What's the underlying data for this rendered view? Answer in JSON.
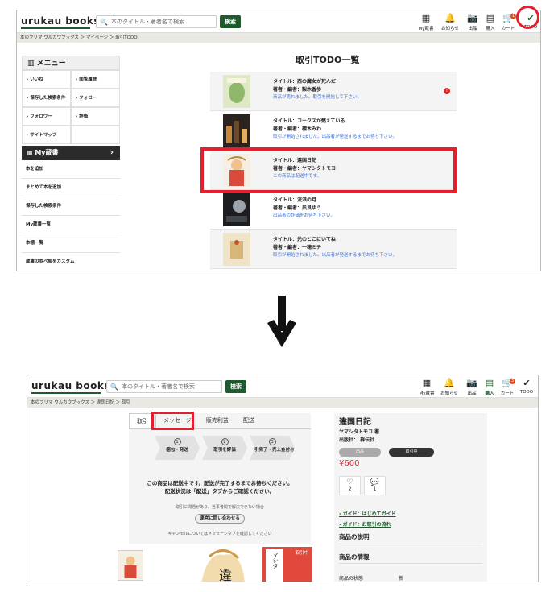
{
  "header": {
    "logo": "urukau books",
    "search_placeholder": "本のタイトル・著者名で検索",
    "search_button": "検索",
    "nav1": [
      {
        "label": "My蔵書",
        "icon": "bookshelf-icon"
      },
      {
        "label": "お知らせ",
        "icon": "bell-icon"
      },
      {
        "label": "出品",
        "icon": "camera-icon"
      },
      {
        "label": "購入",
        "icon": "shop-icon"
      },
      {
        "label": "カート",
        "icon": "cart-icon",
        "badge": "1"
      },
      {
        "label": "TODO",
        "icon": "check-icon"
      }
    ],
    "nav2": [
      {
        "label": "My蔵書",
        "icon": "bookshelf-icon"
      },
      {
        "label": "お知らせ",
        "icon": "bell-icon"
      },
      {
        "label": "出品",
        "icon": "camera-icon"
      },
      {
        "label": "購入",
        "icon": "shop-icon"
      },
      {
        "label": "カート",
        "icon": "cart-icon",
        "badge": "3"
      },
      {
        "label": "TODO",
        "icon": "check-icon"
      }
    ]
  },
  "screen1": {
    "breadcrumb": "本のフリマ ウルカウブックス ＞ マイページ ＞ 取引TODO",
    "menu_title": "メニュー",
    "menu_items": [
      "いいね",
      "閲覧履歴",
      "保存した検索条件",
      "フォロー",
      "フォロワー",
      "評価",
      "サイトマップ"
    ],
    "my_books_title": "My蔵書",
    "my_books_items": [
      "本を追加",
      "まとめて本を追加",
      "保存した検索条件",
      "My蔵書一覧",
      "本棚一覧",
      "蔵書の並べ順をカスタム"
    ],
    "page_title": "取引TODO一覧",
    "rows": [
      {
        "title": "タイトル：西の魔女が死んだ",
        "author": "著者・編者：梨木香歩",
        "message": "商品が売れました。取引を開始して下さい。",
        "alert": "!"
      },
      {
        "title": "タイトル：コークスが燃えている",
        "author": "著者・編者：櫻木みわ",
        "message": "取引が開始されました。出品者が発送するまでお待ち下さい。",
        "alert": ""
      },
      {
        "title": "タイトル：違国日記",
        "author": "著者・編者：ヤマシタトモコ",
        "message": "この商品は配送中です。",
        "alert": ""
      },
      {
        "title": "タイトル：流浪の月",
        "author": "著者・編者：凪良ゆう",
        "message": "出品者の評価をお待ち下さい。",
        "alert": ""
      },
      {
        "title": "タイトル：光のとこにいてね",
        "author": "著者・編者：一穂ミチ",
        "message": "取引が開始されました。出品者が発送するまでお待ち下さい。",
        "alert": ""
      }
    ]
  },
  "screen2": {
    "breadcrumb": "本のフリマ ウルカウブックス ＞ 違国日記 ＞ 取引",
    "tabs": [
      "取引",
      "メッセージ",
      "販売利益",
      "配送"
    ],
    "steps": [
      {
        "num": "1",
        "label": "梱包・発送"
      },
      {
        "num": "2",
        "label": "取引を評価"
      },
      {
        "num": "3",
        "label": "取引完了・売上金付与"
      }
    ],
    "status_line1": "この商品は配送中です。配送が完了するまでお待ちください。",
    "status_line2": "配送状況は「配送」タブからご確認ください。",
    "problem_text": "取引に問題があり、当事者間で解決できない場合",
    "inquiry_button": "運営に問い合わせる",
    "cancel_text": "キャンセルについてはメッセージタブを確認してください",
    "book_title": "違国日記",
    "author": "ヤマシタトモコ 著",
    "publisher": "出版社： 祥伝社",
    "pill1": "出品",
    "pill2": "取引中",
    "price": "¥600",
    "likes": "2",
    "comments": "1",
    "guide1": "ガイド：はじめてガイド",
    "guide2": "ガイド：お取引の流れ",
    "desc_heading": "商品の説明",
    "info_heading": "商品の情報",
    "condition_label": "商品の状態",
    "condition_value": "新品",
    "sale_badge": "取引中",
    "cover_text": "マシタ"
  },
  "colors": {
    "brand_green": "#1e5a2e",
    "highlight_red": "#e4202e",
    "link_blue": "#3a6fd8"
  }
}
